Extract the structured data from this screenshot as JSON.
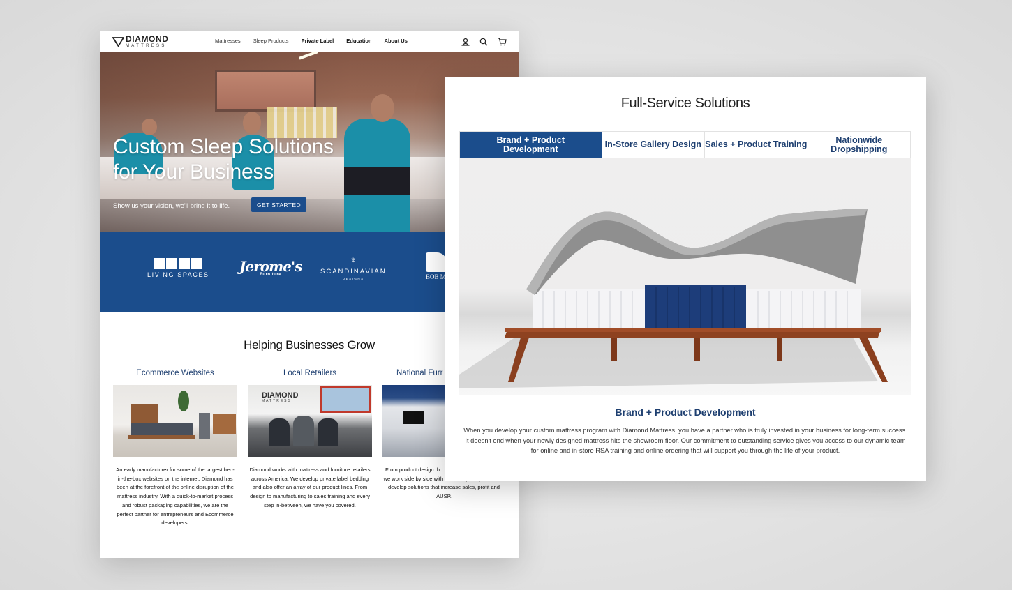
{
  "left_page": {
    "logo": {
      "main": "DIAMOND",
      "sub": "MATTRESS"
    },
    "nav": [
      {
        "label": "Mattresses",
        "bold": false
      },
      {
        "label": "Sleep Products",
        "bold": false
      },
      {
        "label": "Private Label",
        "bold": true
      },
      {
        "label": "Education",
        "bold": true
      },
      {
        "label": "About Us",
        "bold": true
      }
    ],
    "nav_icons": [
      "account-icon",
      "search-icon",
      "cart-icon"
    ],
    "hero": {
      "title_line1": "Custom Sleep Solutions",
      "title_line2": "for Your Business",
      "subtitle": "Show us your vision, we'll bring it to life.",
      "cta_label": "GET STARTED"
    },
    "brands": {
      "living_spaces": "LIVING SPACES",
      "jeromes": "Jerome's",
      "jeromes_sub": "Furniture",
      "scandinavian": "SCANDINAVIAN",
      "scandinavian_sub": "DESIGNS",
      "bob": "BOB M"
    },
    "section_title": "Helping Businesses Grow",
    "columns": [
      {
        "title": "Ecommerce Websites",
        "text": "An early manufacturer for some of the largest bed-in-the-box websites on the internet, Diamond has been at the forefront of the online disruption of the mattress industry. With a quick-to-market process and robust packaging capabilities, we are the perfect partner for entrepreneurs and Ecommerce developers."
      },
      {
        "title": "Local Retailers",
        "text": "Diamond works with mattress and furniture retailers across America. We develop private label bedding and also offer an array of our product lines. From design to manufacturing to sales training and every step in-between, we have you covered.",
        "image_banner": "DIAMOND",
        "image_banner_sub": "MATTRESS"
      },
      {
        "title": "National Furr",
        "text": "From product design th... and in-store experience, we work side by side with our enterprise partners to develop solutions that increase sales, profit and AUSP."
      }
    ]
  },
  "right_page": {
    "title": "Full-Service Solutions",
    "tabs": [
      {
        "label": "Brand + Product Development",
        "active": true
      },
      {
        "label": "In-Store Gallery Design",
        "active": false
      },
      {
        "label": "Sales + Product Training",
        "active": false
      },
      {
        "label": "Nationwide Dropshipping",
        "active": false
      }
    ],
    "subtitle": "Brand + Product Development",
    "text": "When you develop your custom mattress program with Diamond Mattress, you have a partner who is truly invested in your business for long-term success. It doesn't end when your newly designed mattress hits the showroom floor. Our commitment to outstanding service gives you access to our dynamic team for online and in-store RSA training and online ordering that will support you through the life of your product."
  },
  "colors": {
    "brand_blue": "#1b4d8c",
    "heading_blue": "#1e3f70",
    "background": "#e6e6e6"
  }
}
